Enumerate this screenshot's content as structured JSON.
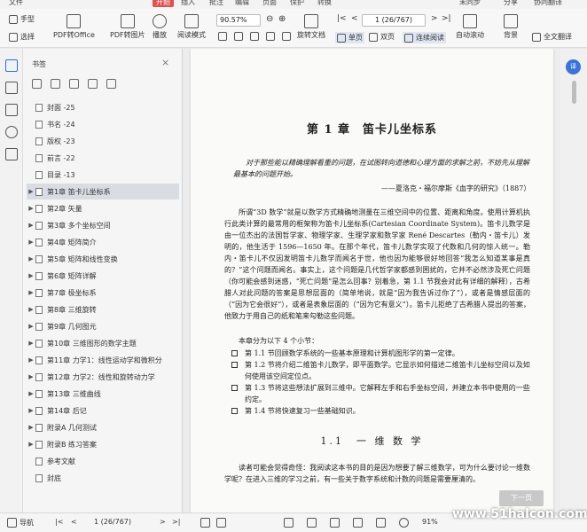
{
  "menubar": {
    "items": [
      "文件",
      "开始",
      "插入",
      "批注",
      "编辑",
      "页面",
      "保护",
      "转换"
    ],
    "right": [
      "未同步",
      "分享",
      "协同翻译"
    ]
  },
  "toolbar": {
    "hand": "手型",
    "select": "选择",
    "pdf_to_office": "PDF转Office",
    "pdf_to_image": "PDF转图片",
    "play": "播放",
    "reading_mode": "阅读模式",
    "zoom": "90.57%",
    "rotate": "旋转文档",
    "single": "单页",
    "double": "双页",
    "continuous": "连续阅读",
    "auto_scroll": "自动滚动",
    "background": "背景",
    "page_indicator": "1 (26/767)",
    "full_translate": "全文翻译"
  },
  "sidebar": {
    "title": "书签",
    "close": "×",
    "items": [
      {
        "label": "封面 -25",
        "arrow": ""
      },
      {
        "label": "书名 -24",
        "arrow": ""
      },
      {
        "label": "版权 -23",
        "arrow": ""
      },
      {
        "label": "前言 -22",
        "arrow": ""
      },
      {
        "label": "目录 -13",
        "arrow": ""
      },
      {
        "label": "第1章 笛卡儿坐标系",
        "arrow": "▶"
      },
      {
        "label": "第2章 矢量",
        "arrow": "▶"
      },
      {
        "label": "第3章 多个坐标空间",
        "arrow": "▶"
      },
      {
        "label": "第4章 矩阵简介",
        "arrow": "▶"
      },
      {
        "label": "第5章 矩阵和线性变换",
        "arrow": "▶"
      },
      {
        "label": "第6章 矩阵详解",
        "arrow": "▶"
      },
      {
        "label": "第7章 极坐标系",
        "arrow": "▶"
      },
      {
        "label": "第8章 三维旋转",
        "arrow": "▶"
      },
      {
        "label": "第9章 几何图元",
        "arrow": "▶"
      },
      {
        "label": "第10章 三维图形的数学主题",
        "arrow": "▶"
      },
      {
        "label": "第11章 力学1：线性运动学和微积分",
        "arrow": "▶"
      },
      {
        "label": "第12章 力学2：线性和旋转动力学",
        "arrow": "▶"
      },
      {
        "label": "第13章 三维曲线",
        "arrow": "▶"
      },
      {
        "label": "第14章 后记",
        "arrow": "▶"
      },
      {
        "label": "附录A 几何测试",
        "arrow": "▶"
      },
      {
        "label": "附录B 练习答案",
        "arrow": "▶"
      },
      {
        "label": "参考文献",
        "arrow": ""
      },
      {
        "label": "封底",
        "arrow": ""
      }
    ],
    "selected_index": 5
  },
  "document": {
    "chapter_title": "第 1 章　笛卡儿坐标系",
    "epigraph": "对于那些能以精确理解看重的问题，在试图转向道德和心理方面的求解之前，不妨先从理解最基本的问题开始。",
    "epigraph_source": "——夏洛克・福尔摩斯《血字的研究》（1887）",
    "paragraph1": "所谓“3D 数学”就是以数学方式精确地测量在三维空间中的位置、距离和角度。使用计算机执行此类计算的最常用的框架称为笛卡儿坐标系(Cartesian Coordinate System)。笛卡儿数学是由一位杰出的法国哲学家、物理学家、生理学家和数学家 René Descartes（勒内・笛卡儿）发明的，他生活于 1596—1650 年。在那个年代，笛卡儿数学实现了代数和几何的惊人统一。勒内・笛卡儿不仅因发明笛卡儿数学而闻名于世，他也因为能够很好地回答“我怎么知道某事是真的？”这个问题而闻名。事实上，这个问题是几代哲学家都感到困扰的，它并不必然涉及死亡问题（你可能会感到迷惑，“死亡问题”是怎么回事？别着急，第 1.1 节我会对此有详细的解释），古希腊人对此问题的答案是思想层面的（简单地说，就是“因为我告诉过你了”），或者是情感层面的（“因为它会很好”），或者是表象层面的（“因为它有意义”）。笛卡儿拒绝了古希腊人提出的答案，他致力于用自己的纸和笔来勾勒这些问题。",
    "paragraph2": "本章分为以下 4 个小节：",
    "bullets": [
      "第 1.1 节回顾数学系统的一些基本原理和计算机图形学的第一定律。",
      "第 1.2 节将介绍二维笛卡儿数学，即平面数学。它显示如何描述二维笛卡儿坐标空间以及如何使用该空间定位点。",
      "第 1.3 节将这些想法扩展到三维中。它解释左手和右手坐标空间，并建立本书中使用的一些约定。",
      "第 1.4 节将快速复习一些基础知识。"
    ],
    "section_title": "1.1　一 维 数 学",
    "paragraph3": "读者可能会觉得奇怪：我阅读这本书的目的是因为想要了解三维数学，可为什么要讨论一维数学呢？在进入三维的学习之前，有一些关于数字系统和计数的问题是需要厘清的。",
    "next_page": "下一页"
  },
  "statusbar": {
    "nav": "导航",
    "page": "1 (26/767)",
    "zoom": "91%"
  },
  "watermark": "www.51halcon.com",
  "colors": {
    "accent": "#2b6fd6",
    "selected_row": "#d9dde3",
    "start_tab": "#e05050"
  }
}
